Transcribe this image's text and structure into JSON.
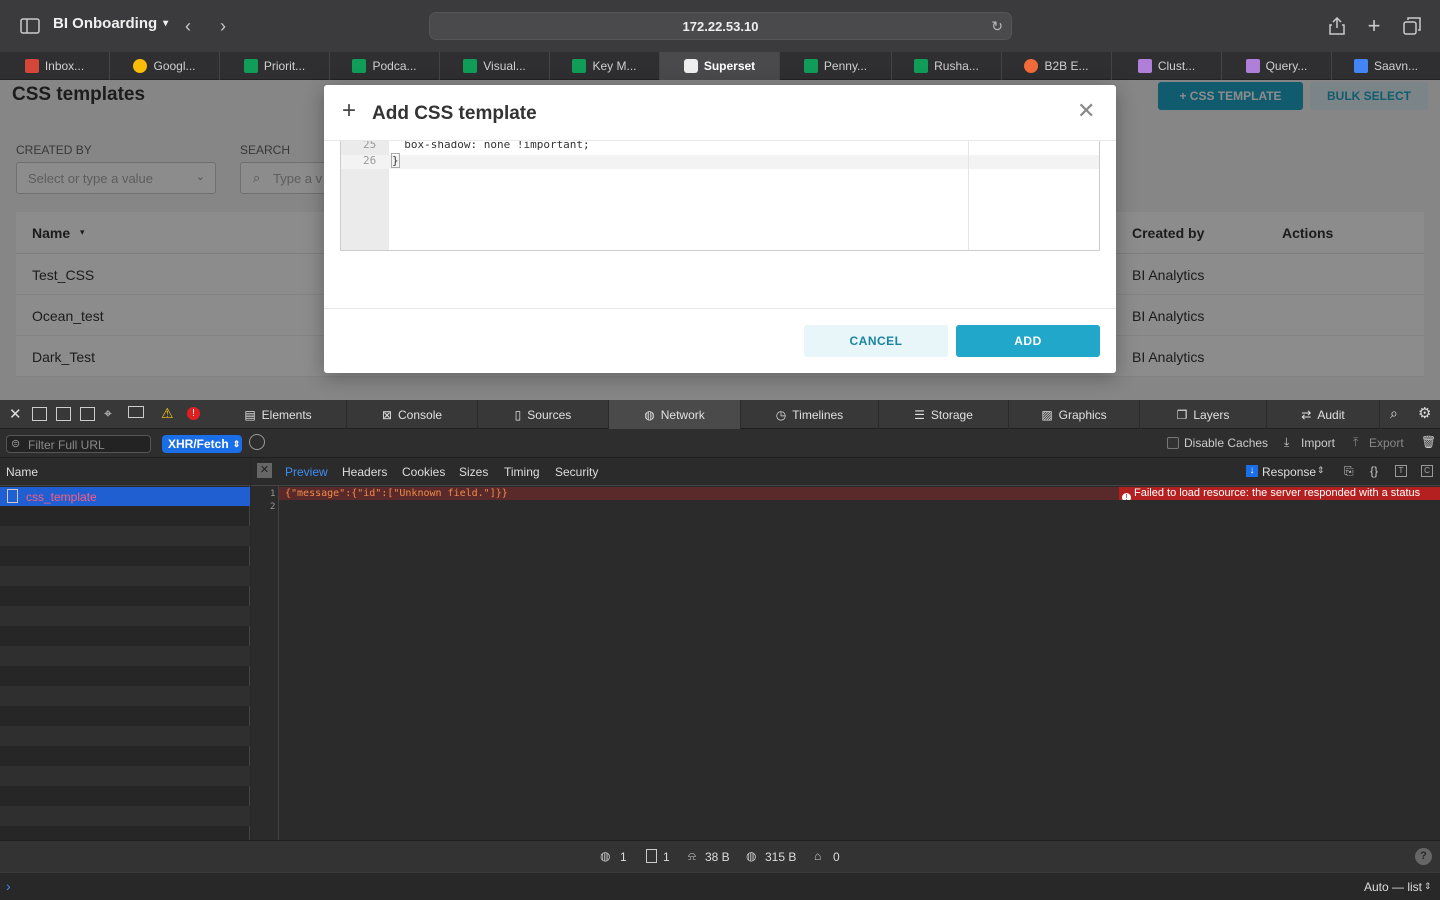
{
  "browser": {
    "profile": "BI Onboarding",
    "url": "172.22.53.10",
    "tabs": [
      {
        "label": "Inbox...",
        "color": "#d44638"
      },
      {
        "label": "Googl...",
        "color": "#fbbc05"
      },
      {
        "label": "Priorit...",
        "color": "#0f9d58"
      },
      {
        "label": "Podca...",
        "color": "#0f9d58"
      },
      {
        "label": "Visual...",
        "color": "#0f9d58"
      },
      {
        "label": "Key M...",
        "color": "#0f9d58"
      },
      {
        "label": "Superset",
        "color": "#ffffff"
      },
      {
        "label": "Penny...",
        "color": "#0f9d58"
      },
      {
        "label": "Rusha...",
        "color": "#0f9d58"
      },
      {
        "label": "B2B E...",
        "color": "#f26b3a"
      },
      {
        "label": "Clust...",
        "color": "#b07fd8"
      },
      {
        "label": "Query...",
        "color": "#b07fd8"
      },
      {
        "label": "Saavn...",
        "color": "#4285f4"
      }
    ]
  },
  "app": {
    "page_title": "CSS templates",
    "add_button": "+ CSS TEMPLATE",
    "bulk_select": "BULK SELECT",
    "created_by_label": "CREATED BY",
    "created_by_placeholder": "Select or type a value",
    "search_label": "SEARCH",
    "search_placeholder": "Type a v",
    "columns": {
      "name": "Name",
      "created_by": "Created by",
      "actions": "Actions"
    },
    "rows": [
      {
        "name": "Test_CSS",
        "created_by": "BI Analytics"
      },
      {
        "name": "Ocean_test",
        "created_by": "BI Analytics"
      },
      {
        "name": "Dark_Test",
        "created_by": "BI Analytics"
      }
    ]
  },
  "modal": {
    "title": "Add CSS template",
    "editor_lines": [
      {
        "num": "25",
        "code": "  box-shadow: none !important;"
      },
      {
        "num": "26",
        "code": "}"
      }
    ],
    "cancel": "CANCEL",
    "add": "ADD"
  },
  "devtools": {
    "tabs": [
      "Elements",
      "Console",
      "Sources",
      "Network",
      "Timelines",
      "Storage",
      "Graphics",
      "Layers",
      "Audit"
    ],
    "filter_placeholder": "Filter Full URL",
    "type_filter": "XHR/Fetch",
    "disable_caches": "Disable Caches",
    "import": "Import",
    "export": "Export",
    "list_header": "Name",
    "request": "css_template",
    "preview_tabs": [
      "Preview",
      "Headers",
      "Cookies",
      "Sizes",
      "Timing",
      "Security"
    ],
    "response_selector": "Response",
    "response_line1": "{\"message\":{\"id\":[\"Unknown field.\"]}}",
    "line_numbers": [
      "1",
      "2"
    ],
    "error_text": "Failed to load resource: the server responded with a status",
    "stats": {
      "requests": "1",
      "resources": "1",
      "transferred": "38 B",
      "size": "315 B",
      "errors": "0"
    },
    "console_mode": "Auto — list"
  }
}
